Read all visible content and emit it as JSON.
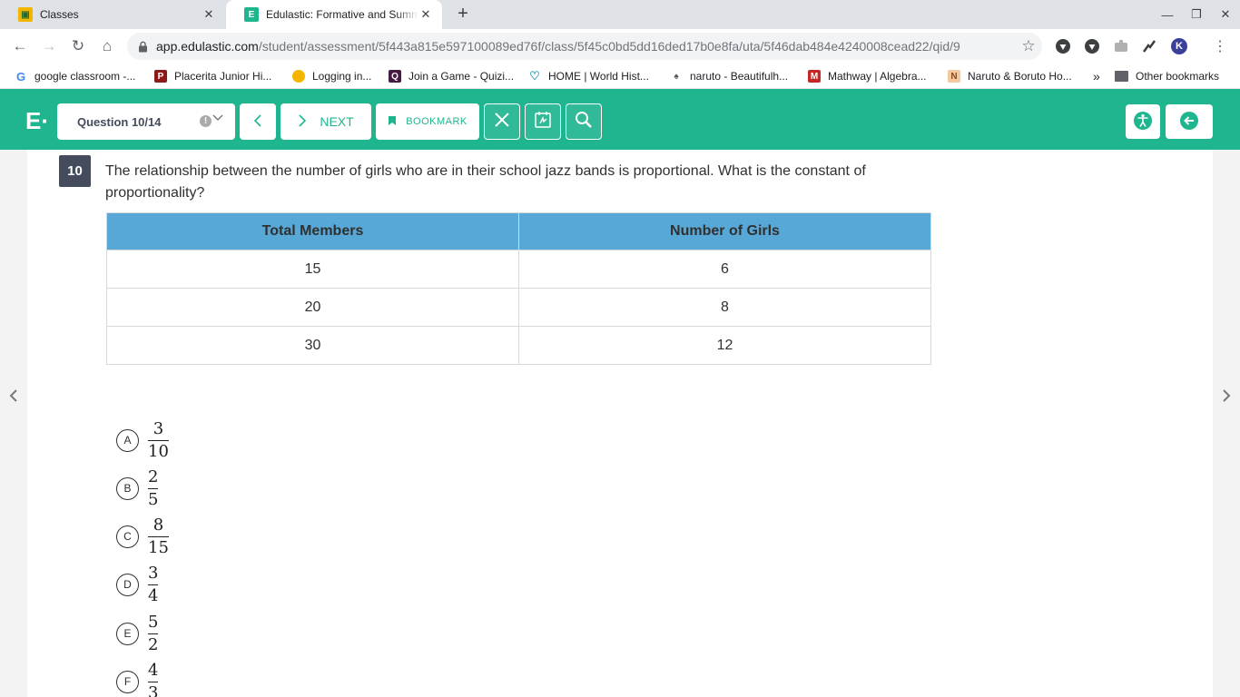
{
  "browser": {
    "tabs": [
      {
        "title": "Classes"
      },
      {
        "title": "Edulastic: Formative and Summ"
      }
    ],
    "new_tab_symbol": "+",
    "url_host": "app.edulastic.com",
    "url_path": "/student/assessment/5f443a815e597100089ed76f/class/5f45c0bd5dd16ded17b0e8fa/uta/5f46dab484e4240008cead22/qid/9",
    "extension_letter": "K"
  },
  "bookmarks": [
    {
      "label": "google classroom -..."
    },
    {
      "label": "Placerita Junior Hi..."
    },
    {
      "label": "Logging in..."
    },
    {
      "label": "Join a Game - Quizi..."
    },
    {
      "label": "HOME | World Hist..."
    },
    {
      "label": "naruto - Beautifulh..."
    },
    {
      "label": "Mathway | Algebra..."
    },
    {
      "label": "Naruto & Boruto Ho..."
    }
  ],
  "bookmarks_overflow": "»",
  "other_bookmarks": "Other bookmarks",
  "header": {
    "logo": "E·",
    "question_selector": "Question 10/14",
    "next_label": "NEXT",
    "bookmark_label": "BOOKMARK"
  },
  "question": {
    "number": "10",
    "text": "The relationship between the number of girls who are in their school jazz bands is proportional. What is the constant of proportionality?",
    "table": {
      "headers": [
        "Total Members",
        "Number of Girls"
      ],
      "rows": [
        [
          "15",
          "6"
        ],
        [
          "20",
          "8"
        ],
        [
          "30",
          "12"
        ]
      ]
    },
    "choices": [
      {
        "letter": "A",
        "num": "3",
        "den": "10"
      },
      {
        "letter": "B",
        "num": "2",
        "den": "5"
      },
      {
        "letter": "C",
        "num": "8",
        "den": "15"
      },
      {
        "letter": "D",
        "num": "3",
        "den": "4"
      },
      {
        "letter": "E",
        "num": "5",
        "den": "2"
      },
      {
        "letter": "F",
        "num": "4",
        "den": "3"
      }
    ]
  },
  "colors": {
    "brand": "#1fb58f",
    "table_header": "#57a8d6",
    "question_badge": "#434b5d"
  }
}
